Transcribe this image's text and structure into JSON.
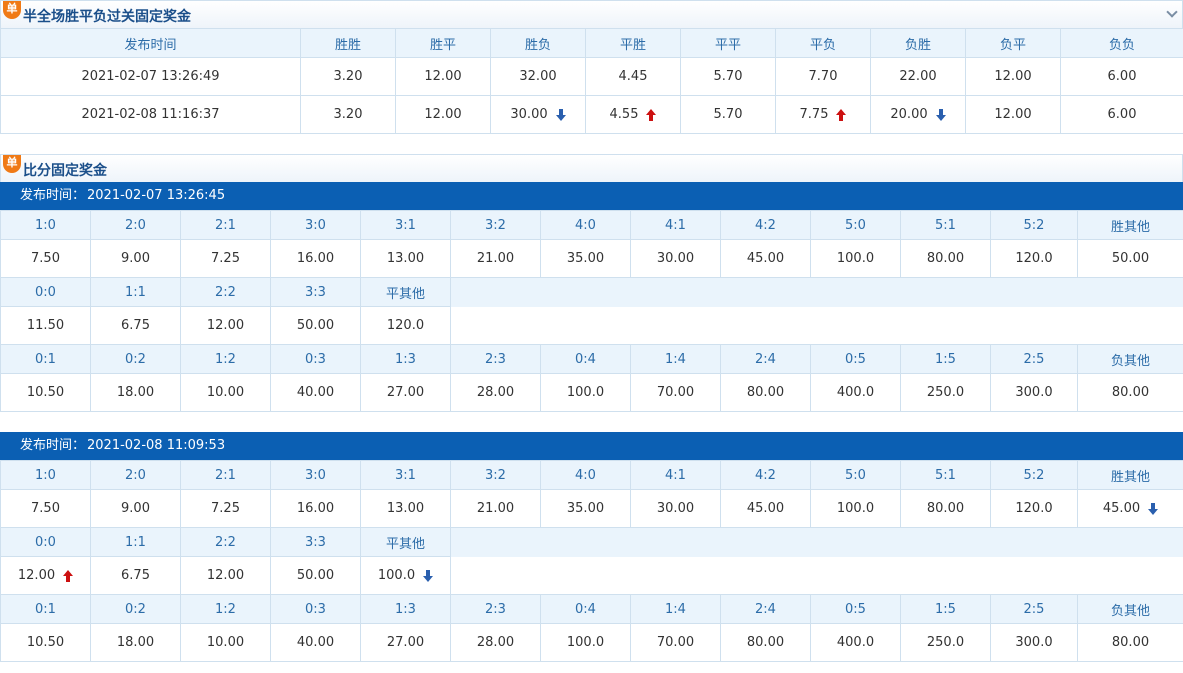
{
  "section1": {
    "badge": "单",
    "title": "半全场胜平负过关固定奖金",
    "headers": [
      "发布时间",
      "胜胜",
      "胜平",
      "胜负",
      "平胜",
      "平平",
      "平负",
      "负胜",
      "负平",
      "负负"
    ],
    "rows": [
      {
        "time": "2021-02-07 13:26:49",
        "cells": [
          {
            "v": "3.20"
          },
          {
            "v": "12.00"
          },
          {
            "v": "32.00"
          },
          {
            "v": "4.45"
          },
          {
            "v": "5.70"
          },
          {
            "v": "7.70"
          },
          {
            "v": "22.00"
          },
          {
            "v": "12.00"
          },
          {
            "v": "6.00"
          }
        ]
      },
      {
        "time": "2021-02-08 11:16:37",
        "cells": [
          {
            "v": "3.20"
          },
          {
            "v": "12.00"
          },
          {
            "v": "30.00",
            "t": "down"
          },
          {
            "v": "4.55",
            "t": "up"
          },
          {
            "v": "5.70"
          },
          {
            "v": "7.75",
            "t": "up"
          },
          {
            "v": "20.00",
            "t": "down"
          },
          {
            "v": "12.00"
          },
          {
            "v": "6.00"
          }
        ]
      }
    ]
  },
  "section2": {
    "badge": "单",
    "title": "比分固定奖金",
    "publish_label": "发布时间：",
    "blocks": [
      {
        "time": "2021-02-07 13:26:45",
        "win_headers": [
          "1:0",
          "2:0",
          "2:1",
          "3:0",
          "3:1",
          "3:2",
          "4:0",
          "4:1",
          "4:2",
          "5:0",
          "5:1",
          "5:2",
          "胜其他"
        ],
        "win_values": [
          {
            "v": "7.50"
          },
          {
            "v": "9.00"
          },
          {
            "v": "7.25"
          },
          {
            "v": "16.00"
          },
          {
            "v": "13.00"
          },
          {
            "v": "21.00"
          },
          {
            "v": "35.00"
          },
          {
            "v": "30.00"
          },
          {
            "v": "45.00"
          },
          {
            "v": "100.0"
          },
          {
            "v": "80.00"
          },
          {
            "v": "120.0"
          },
          {
            "v": "50.00"
          }
        ],
        "draw_headers": [
          "0:0",
          "1:1",
          "2:2",
          "3:3",
          "平其他"
        ],
        "draw_values": [
          {
            "v": "11.50"
          },
          {
            "v": "6.75"
          },
          {
            "v": "12.00"
          },
          {
            "v": "50.00"
          },
          {
            "v": "120.0"
          }
        ],
        "lose_headers": [
          "0:1",
          "0:2",
          "1:2",
          "0:3",
          "1:3",
          "2:3",
          "0:4",
          "1:4",
          "2:4",
          "0:5",
          "1:5",
          "2:5",
          "负其他"
        ],
        "lose_values": [
          {
            "v": "10.50"
          },
          {
            "v": "18.00"
          },
          {
            "v": "10.00"
          },
          {
            "v": "40.00"
          },
          {
            "v": "27.00"
          },
          {
            "v": "28.00"
          },
          {
            "v": "100.0"
          },
          {
            "v": "70.00"
          },
          {
            "v": "80.00"
          },
          {
            "v": "400.0"
          },
          {
            "v": "250.0"
          },
          {
            "v": "300.0"
          },
          {
            "v": "80.00"
          }
        ]
      },
      {
        "time": "2021-02-08 11:09:53",
        "win_headers": [
          "1:0",
          "2:0",
          "2:1",
          "3:0",
          "3:1",
          "3:2",
          "4:0",
          "4:1",
          "4:2",
          "5:0",
          "5:1",
          "5:2",
          "胜其他"
        ],
        "win_values": [
          {
            "v": "7.50"
          },
          {
            "v": "9.00"
          },
          {
            "v": "7.25"
          },
          {
            "v": "16.00"
          },
          {
            "v": "13.00"
          },
          {
            "v": "21.00"
          },
          {
            "v": "35.00"
          },
          {
            "v": "30.00"
          },
          {
            "v": "45.00"
          },
          {
            "v": "100.0"
          },
          {
            "v": "80.00"
          },
          {
            "v": "120.0"
          },
          {
            "v": "45.00",
            "t": "down"
          }
        ],
        "draw_headers": [
          "0:0",
          "1:1",
          "2:2",
          "3:3",
          "平其他"
        ],
        "draw_values": [
          {
            "v": "12.00",
            "t": "up"
          },
          {
            "v": "6.75"
          },
          {
            "v": "12.00"
          },
          {
            "v": "50.00"
          },
          {
            "v": "100.0",
            "t": "down"
          }
        ],
        "lose_headers": [
          "0:1",
          "0:2",
          "1:2",
          "0:3",
          "1:3",
          "2:3",
          "0:4",
          "1:4",
          "2:4",
          "0:5",
          "1:5",
          "2:5",
          "负其他"
        ],
        "lose_values": [
          {
            "v": "10.50"
          },
          {
            "v": "18.00"
          },
          {
            "v": "10.00"
          },
          {
            "v": "40.00"
          },
          {
            "v": "27.00"
          },
          {
            "v": "28.00"
          },
          {
            "v": "100.0"
          },
          {
            "v": "70.00"
          },
          {
            "v": "80.00"
          },
          {
            "v": "400.0"
          },
          {
            "v": "250.0"
          },
          {
            "v": "300.0"
          },
          {
            "v": "80.00"
          }
        ]
      }
    ]
  }
}
